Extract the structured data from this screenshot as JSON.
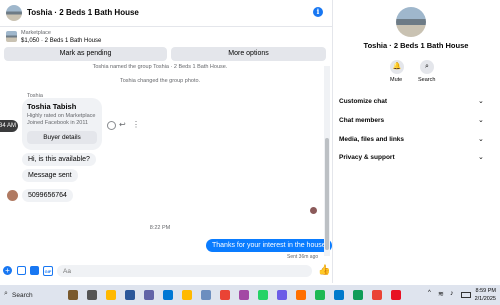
{
  "header": {
    "title": "Toshia · 2 Beds 1 Bath House",
    "info_icon": "info-icon"
  },
  "listing": {
    "source": "Marketplace",
    "title": "$1,050 · 2 Beds 1 Bath House"
  },
  "actions": {
    "pending": "Mark as pending",
    "more": "More options"
  },
  "chat": {
    "system_1": "Toshia named the group Toshia · 2 Beds 1 Bath House.",
    "system_2": "Toshia changed the group photo.",
    "sender": "Toshia",
    "card": {
      "name": "Toshia Tabish",
      "line1": "Highly rated on Marketplace",
      "line2": "Joined Facebook in 2011",
      "button": "Buyer details"
    },
    "time_chip": "8:34 AM",
    "messages": [
      "Hi, is this available?",
      "Message sent",
      "5099656764"
    ],
    "time_divider": "8:22 PM",
    "sent_message": "Thanks for your interest in the house",
    "sent_meta": "Sent 36m ago"
  },
  "composer": {
    "placeholder": "Aa"
  },
  "right_panel": {
    "name": "Toshia · 2 Beds 1 Bath House",
    "mute": "Mute",
    "search": "Search",
    "rows": [
      "Customize chat",
      "Chat members",
      "Media, files and links",
      "Privacy & support"
    ]
  },
  "taskbar": {
    "search": "Search",
    "time": "8:59 PM",
    "date": "2/1/2025",
    "apps": [
      "#7a5a2e",
      "#555555",
      "#ffb900",
      "#2b579a",
      "#6264a7",
      "#0078d4",
      "#ffb900",
      "#6c8ebf",
      "#ea4335",
      "#a349a4",
      "#25d366",
      "#6c5ce7",
      "#ff6f00",
      "#1db954",
      "#007acc",
      "#0f9d58",
      "#ea4335",
      "#e81123"
    ]
  },
  "colors": {
    "accent": "#1877f2",
    "sent_bubble": "#0a7cff"
  }
}
